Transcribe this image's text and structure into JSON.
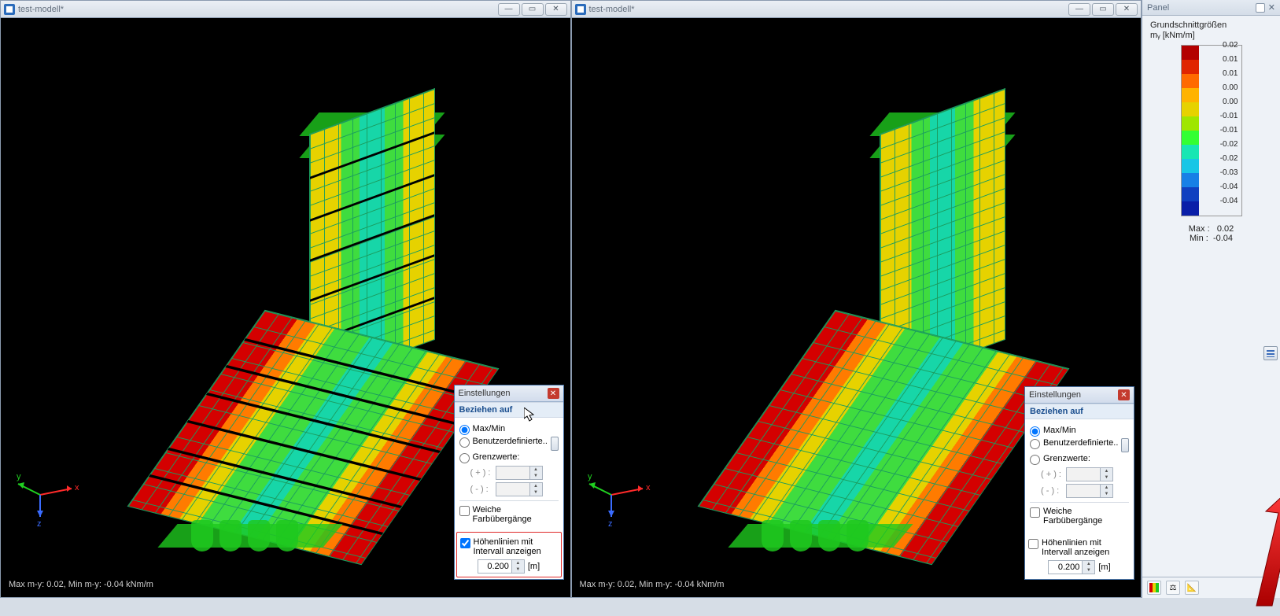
{
  "viewport": {
    "title": "test-modell*",
    "status": "Max m-y: 0.02, Min m-y: -0.04 kNm/m"
  },
  "dialog": {
    "title": "Einstellungen",
    "section_ref": "Beziehen auf",
    "opt_maxmin": "Max/Min",
    "opt_custom": "Benutzerdefinierte..",
    "opt_limits": "Grenzwerte:",
    "limit_plus": "( + ) :",
    "limit_minus": "( - ) :",
    "chk_smooth": "Weiche Farbübergänge",
    "chk_contours": "Höhenlinien mit Intervall anzeigen",
    "interval_value": "0.200",
    "interval_unit": "[m]"
  },
  "panel": {
    "title": "Panel",
    "legend_title": "Grundschnittgrößen",
    "legend_sub": "mᵧ [kNm/m]",
    "max_label": "Max :",
    "max_value": "0.02",
    "min_label": "Min :",
    "min_value": "-0.04"
  },
  "chart_data": {
    "type": "table",
    "title": "Color scale legend",
    "entries": [
      {
        "color": "#b30000",
        "value": 0.02
      },
      {
        "color": "#e02500",
        "value": 0.01
      },
      {
        "color": "#ff6a00",
        "value": 0.01
      },
      {
        "color": "#ffb300",
        "value": 0.0
      },
      {
        "color": "#e6d200",
        "value": 0.0
      },
      {
        "color": "#9fe600",
        "value": -0.01
      },
      {
        "color": "#33ff33",
        "value": -0.01
      },
      {
        "color": "#17e6b3",
        "value": -0.02
      },
      {
        "color": "#17c6e6",
        "value": -0.02
      },
      {
        "color": "#1780e6",
        "value": -0.03
      },
      {
        "color": "#1040c0",
        "value": -0.04
      },
      {
        "color": "#0a1fa8",
        "value": -0.04
      }
    ]
  }
}
